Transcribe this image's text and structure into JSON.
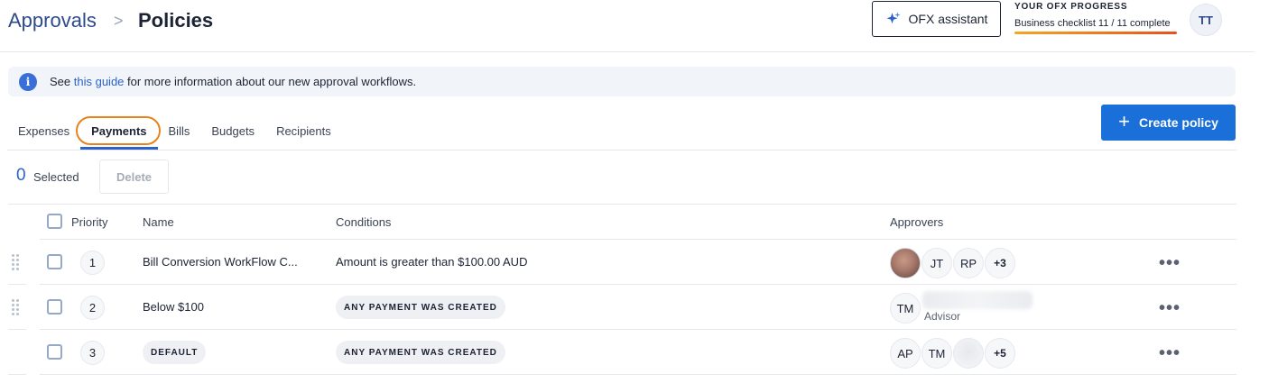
{
  "breadcrumb": {
    "root": "Approvals",
    "separator": ">",
    "current": "Policies"
  },
  "assistant": {
    "label": "OFX assistant",
    "icon": "sparkle-icon"
  },
  "progress": {
    "title": "YOUR OFX PROGRESS",
    "subtitle": "Business checklist 11 / 11 complete",
    "completed": 11,
    "total": 11
  },
  "user_avatar": {
    "initials": "TT"
  },
  "banner": {
    "prefix": "See ",
    "link": "this guide",
    "suffix": " for more information about our new approval workflows.",
    "icon": "info-icon"
  },
  "tabs": [
    {
      "label": "Expenses"
    },
    {
      "label": "Payments",
      "active": true
    },
    {
      "label": "Bills"
    },
    {
      "label": "Budgets"
    },
    {
      "label": "Recipients"
    }
  ],
  "create_button": {
    "label": "Create policy",
    "icon": "plus-icon"
  },
  "selection": {
    "count": "0",
    "label": "Selected",
    "delete_label": "Delete"
  },
  "table": {
    "headers": {
      "priority": "Priority",
      "name": "Name",
      "conditions": "Conditions",
      "approvers": "Approvers"
    },
    "rows": [
      {
        "priority": "1",
        "name": "Bill Conversion WorkFlow C...",
        "condition": "Amount is greater than $100.00 AUD",
        "approvers": [
          "JT",
          "RP"
        ],
        "more": "+3"
      },
      {
        "priority": "2",
        "name": "Below $100",
        "condition": "ANY PAYMENT WAS CREATED",
        "approvers": [
          "TM"
        ],
        "approver_role": "Advisor"
      },
      {
        "priority": "3",
        "name": "DEFAULT",
        "condition": "ANY PAYMENT WAS CREATED",
        "approvers": [
          "AP",
          "TM"
        ],
        "more": "+5"
      }
    ],
    "row_menu": "•••"
  },
  "colors": {
    "accent": "#1b6fd9",
    "highlight": "#e8821c",
    "brand_text": "#2d4a8a"
  }
}
